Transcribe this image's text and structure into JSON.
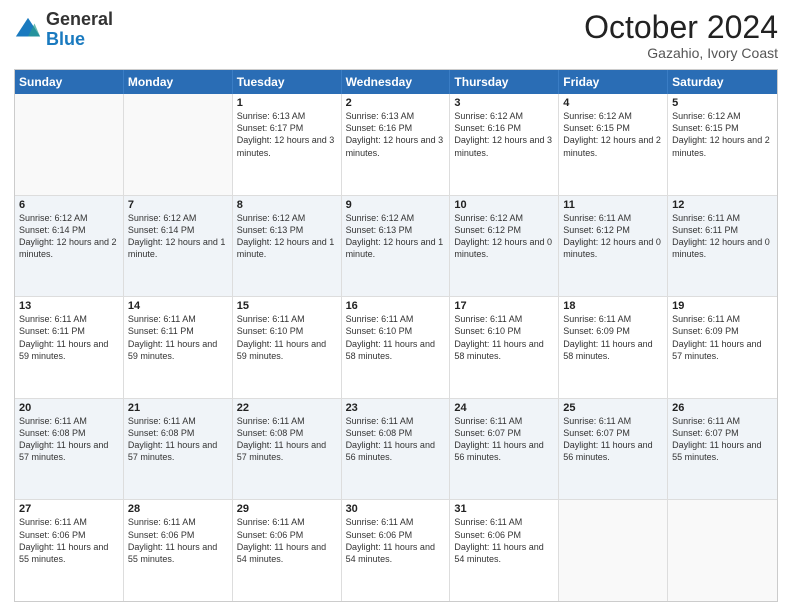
{
  "logo": {
    "general": "General",
    "blue": "Blue"
  },
  "title": "October 2024",
  "subtitle": "Gazahio, Ivory Coast",
  "header_days": [
    "Sunday",
    "Monday",
    "Tuesday",
    "Wednesday",
    "Thursday",
    "Friday",
    "Saturday"
  ],
  "weeks": [
    [
      {
        "day": "",
        "text": ""
      },
      {
        "day": "",
        "text": ""
      },
      {
        "day": "1",
        "text": "Sunrise: 6:13 AM\nSunset: 6:17 PM\nDaylight: 12 hours and 3 minutes."
      },
      {
        "day": "2",
        "text": "Sunrise: 6:13 AM\nSunset: 6:16 PM\nDaylight: 12 hours and 3 minutes."
      },
      {
        "day": "3",
        "text": "Sunrise: 6:12 AM\nSunset: 6:16 PM\nDaylight: 12 hours and 3 minutes."
      },
      {
        "day": "4",
        "text": "Sunrise: 6:12 AM\nSunset: 6:15 PM\nDaylight: 12 hours and 2 minutes."
      },
      {
        "day": "5",
        "text": "Sunrise: 6:12 AM\nSunset: 6:15 PM\nDaylight: 12 hours and 2 minutes."
      }
    ],
    [
      {
        "day": "6",
        "text": "Sunrise: 6:12 AM\nSunset: 6:14 PM\nDaylight: 12 hours and 2 minutes."
      },
      {
        "day": "7",
        "text": "Sunrise: 6:12 AM\nSunset: 6:14 PM\nDaylight: 12 hours and 1 minute."
      },
      {
        "day": "8",
        "text": "Sunrise: 6:12 AM\nSunset: 6:13 PM\nDaylight: 12 hours and 1 minute."
      },
      {
        "day": "9",
        "text": "Sunrise: 6:12 AM\nSunset: 6:13 PM\nDaylight: 12 hours and 1 minute."
      },
      {
        "day": "10",
        "text": "Sunrise: 6:12 AM\nSunset: 6:12 PM\nDaylight: 12 hours and 0 minutes."
      },
      {
        "day": "11",
        "text": "Sunrise: 6:11 AM\nSunset: 6:12 PM\nDaylight: 12 hours and 0 minutes."
      },
      {
        "day": "12",
        "text": "Sunrise: 6:11 AM\nSunset: 6:11 PM\nDaylight: 12 hours and 0 minutes."
      }
    ],
    [
      {
        "day": "13",
        "text": "Sunrise: 6:11 AM\nSunset: 6:11 PM\nDaylight: 11 hours and 59 minutes."
      },
      {
        "day": "14",
        "text": "Sunrise: 6:11 AM\nSunset: 6:11 PM\nDaylight: 11 hours and 59 minutes."
      },
      {
        "day": "15",
        "text": "Sunrise: 6:11 AM\nSunset: 6:10 PM\nDaylight: 11 hours and 59 minutes."
      },
      {
        "day": "16",
        "text": "Sunrise: 6:11 AM\nSunset: 6:10 PM\nDaylight: 11 hours and 58 minutes."
      },
      {
        "day": "17",
        "text": "Sunrise: 6:11 AM\nSunset: 6:10 PM\nDaylight: 11 hours and 58 minutes."
      },
      {
        "day": "18",
        "text": "Sunrise: 6:11 AM\nSunset: 6:09 PM\nDaylight: 11 hours and 58 minutes."
      },
      {
        "day": "19",
        "text": "Sunrise: 6:11 AM\nSunset: 6:09 PM\nDaylight: 11 hours and 57 minutes."
      }
    ],
    [
      {
        "day": "20",
        "text": "Sunrise: 6:11 AM\nSunset: 6:08 PM\nDaylight: 11 hours and 57 minutes."
      },
      {
        "day": "21",
        "text": "Sunrise: 6:11 AM\nSunset: 6:08 PM\nDaylight: 11 hours and 57 minutes."
      },
      {
        "day": "22",
        "text": "Sunrise: 6:11 AM\nSunset: 6:08 PM\nDaylight: 11 hours and 57 minutes."
      },
      {
        "day": "23",
        "text": "Sunrise: 6:11 AM\nSunset: 6:08 PM\nDaylight: 11 hours and 56 minutes."
      },
      {
        "day": "24",
        "text": "Sunrise: 6:11 AM\nSunset: 6:07 PM\nDaylight: 11 hours and 56 minutes."
      },
      {
        "day": "25",
        "text": "Sunrise: 6:11 AM\nSunset: 6:07 PM\nDaylight: 11 hours and 56 minutes."
      },
      {
        "day": "26",
        "text": "Sunrise: 6:11 AM\nSunset: 6:07 PM\nDaylight: 11 hours and 55 minutes."
      }
    ],
    [
      {
        "day": "27",
        "text": "Sunrise: 6:11 AM\nSunset: 6:06 PM\nDaylight: 11 hours and 55 minutes."
      },
      {
        "day": "28",
        "text": "Sunrise: 6:11 AM\nSunset: 6:06 PM\nDaylight: 11 hours and 55 minutes."
      },
      {
        "day": "29",
        "text": "Sunrise: 6:11 AM\nSunset: 6:06 PM\nDaylight: 11 hours and 54 minutes."
      },
      {
        "day": "30",
        "text": "Sunrise: 6:11 AM\nSunset: 6:06 PM\nDaylight: 11 hours and 54 minutes."
      },
      {
        "day": "31",
        "text": "Sunrise: 6:11 AM\nSunset: 6:06 PM\nDaylight: 11 hours and 54 minutes."
      },
      {
        "day": "",
        "text": ""
      },
      {
        "day": "",
        "text": ""
      }
    ]
  ]
}
